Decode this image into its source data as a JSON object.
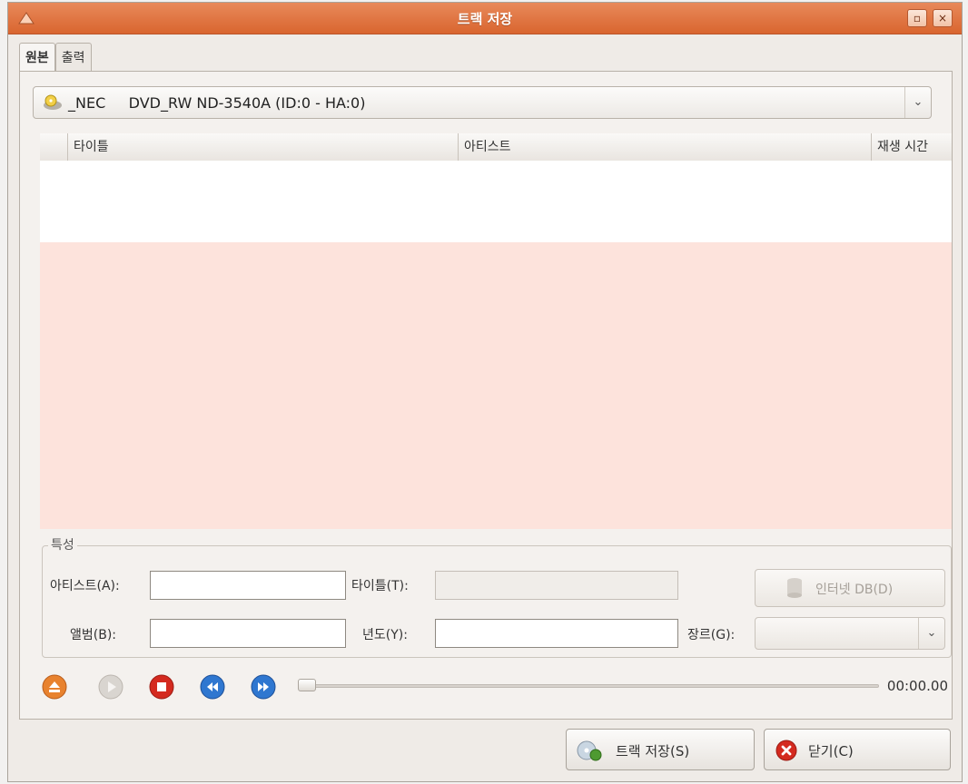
{
  "window": {
    "title": "트랙 저장"
  },
  "tabs": [
    {
      "label": "원본",
      "active": true
    },
    {
      "label": "출력",
      "active": false
    }
  ],
  "drive": {
    "selected": "_NEC     DVD_RW ND-3540A (ID:0 - HA:0)"
  },
  "track_table": {
    "columns": [
      "타이틀",
      "아티스트",
      "재생 시간"
    ],
    "rows": []
  },
  "properties": {
    "legend": "특성",
    "artist_label": "아티스트(A):",
    "artist_value": "",
    "title_label": "타이틀(T):",
    "title_value": "",
    "album_label": "앨범(B):",
    "album_value": "",
    "year_label": "년도(Y):",
    "year_value": "",
    "genre_label": "장르(G):",
    "genre_value": "",
    "internet_db_label": "인터넷 DB(D)"
  },
  "player": {
    "time": "00:00.00",
    "position": 0
  },
  "buttons": {
    "save_tracks": "트랙 저장(S)",
    "close": "닫기(C)"
  },
  "colors": {
    "titlebar": "#df7140",
    "list_background": "#fde3dc",
    "eject": "#e8822e",
    "stop": "#d42a1f",
    "prev_next": "#2f77d0"
  }
}
